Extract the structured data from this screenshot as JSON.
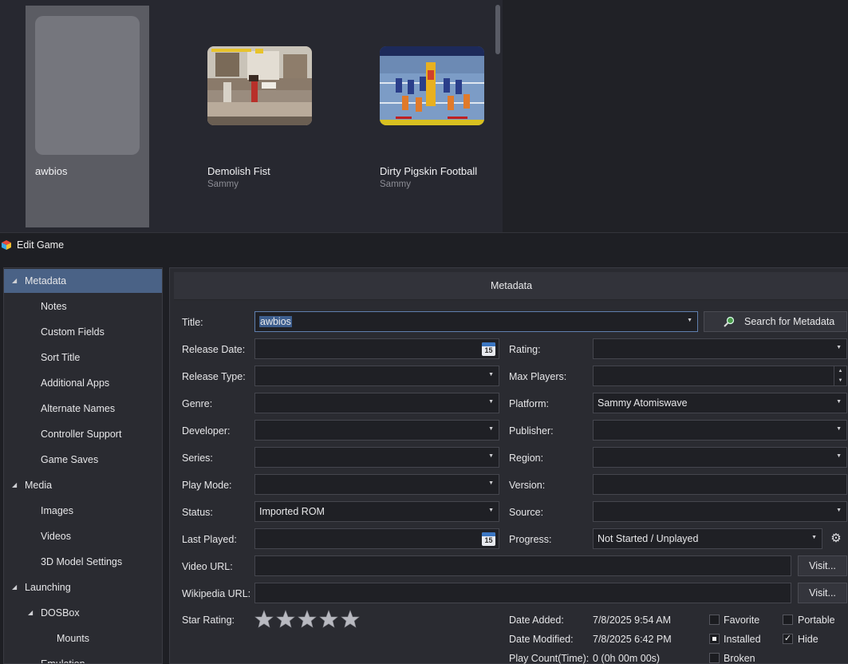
{
  "games": [
    {
      "name": "awbios",
      "publisher": ""
    },
    {
      "name": "Demolish Fist",
      "publisher": "Sammy"
    },
    {
      "name": "Dirty Pigskin Football",
      "publisher": "Sammy"
    }
  ],
  "window": {
    "title": "Edit Game"
  },
  "tree": [
    {
      "label": "Metadata"
    },
    {
      "label": "Notes"
    },
    {
      "label": "Custom Fields"
    },
    {
      "label": "Sort Title"
    },
    {
      "label": "Additional Apps"
    },
    {
      "label": "Alternate Names"
    },
    {
      "label": "Controller Support"
    },
    {
      "label": "Game Saves"
    },
    {
      "label": "Media"
    },
    {
      "label": "Images"
    },
    {
      "label": "Videos"
    },
    {
      "label": "3D Model Settings"
    },
    {
      "label": "Launching"
    },
    {
      "label": "DOSBox"
    },
    {
      "label": "Mounts"
    },
    {
      "label": "Emulation"
    }
  ],
  "panel": {
    "header": "Metadata"
  },
  "form": {
    "title_label": "Title:",
    "title_value": "awbios",
    "search_button": "Search for Metadata",
    "release_date_label": "Release Date:",
    "release_type_label": "Release Type:",
    "genre_label": "Genre:",
    "developer_label": "Developer:",
    "series_label": "Series:",
    "play_mode_label": "Play Mode:",
    "status_label": "Status:",
    "status_value": "Imported ROM",
    "last_played_label": "Last Played:",
    "video_url_label": "Video URL:",
    "wikipedia_url_label": "Wikipedia URL:",
    "star_rating_label": "Star Rating:",
    "star_rating_value": 0,
    "rating_label": "Rating:",
    "max_players_label": "Max Players:",
    "platform_label": "Platform:",
    "platform_value": "Sammy Atomiswave",
    "publisher_label": "Publisher:",
    "region_label": "Region:",
    "version_label": "Version:",
    "source_label": "Source:",
    "progress_label": "Progress:",
    "progress_value": "Not Started / Unplayed",
    "visit_label": "Visit...",
    "calendar_day": "15",
    "date_added_label": "Date Added:",
    "date_added_value": "7/8/2025 9:54 AM",
    "date_modified_label": "Date Modified:",
    "date_modified_value": "7/8/2025 6:42 PM",
    "play_count_label": "Play Count(Time):",
    "play_count_value": "0 (0h 00m 00s)"
  },
  "checkboxes": {
    "favorite": {
      "label": "Favorite",
      "checked": false
    },
    "portable": {
      "label": "Portable",
      "checked": false
    },
    "installed": {
      "label": "Installed",
      "checked": true
    },
    "hide": {
      "label": "Hide",
      "checked": true
    },
    "broken": {
      "label": "Broken",
      "checked": false
    }
  },
  "icons": {
    "search": "magnifier-icon",
    "calendar": "calendar-icon",
    "dropdown": "chevron-down-icon",
    "gear": "gear-icon",
    "star": "star-icon",
    "app": "launchbox-icon"
  }
}
